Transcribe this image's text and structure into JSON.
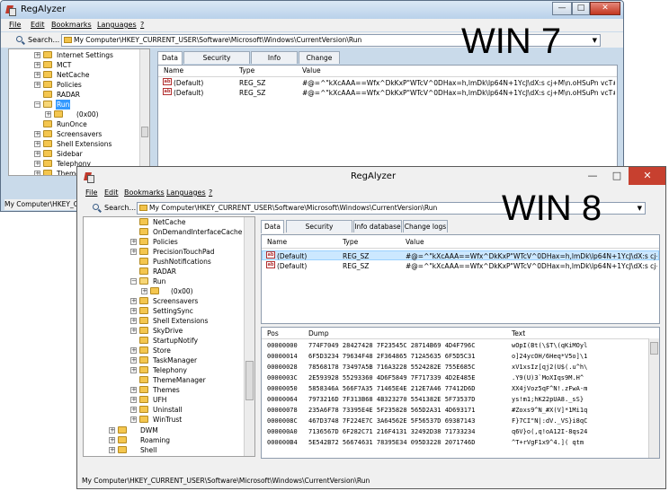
{
  "win7": {
    "title": "RegAlyzer",
    "label": "WIN 7",
    "menu": {
      "file": "File",
      "edit": "Edit",
      "bookmarks": "Bookmarks",
      "languages": "Languages",
      "help": "?"
    },
    "search_label": "Search...",
    "path": "My Computer\\HKEY_CURRENT_USER\\Software\\Microsoft\\Windows\\CurrentVersion\\Run",
    "tree": [
      "Internet Settings",
      "MCT",
      "NetCache",
      "Policies",
      "RADAR",
      "Run",
      "(0x00)",
      "RunOnce",
      "Screensavers",
      "Shell Extensions",
      "Sidebar",
      "Telephony",
      "Themes"
    ],
    "tabs": [
      "Data",
      "Security information",
      "Info database",
      "Change logs"
    ],
    "columns": [
      "Name",
      "Type",
      "Value"
    ],
    "rows": [
      {
        "name": "(Default)",
        "type": "REG_SZ",
        "value": "#@=^\"kXcAAA==Wfx^DkKxP\"WTcV^0DHax=h,lmDk\\lp64N+1YcJ\\dX:s cj+M\\n.oHSuPn vcT#lX..."
      },
      {
        "name": "(Default)",
        "type": "REG_SZ",
        "value": "#@=^\"kXcAAA==Wfx^DkKxP\"WTcV^0DHax=h,lmDk\\lp64N+1YcJ\\dX:s cj+M\\n.oHSuPn vcT#lX..."
      }
    ],
    "status": "My Computer\\HKEY_CU..."
  },
  "win8": {
    "title": "RegAlyzer",
    "label": "WIN 8",
    "menu": {
      "file": "File",
      "edit": "Edit",
      "bookmarks": "Bookmarks",
      "languages": "Languages",
      "help": "?"
    },
    "search_label": "Search...",
    "path": "My Computer\\HKEY_CURRENT_USER\\Software\\Microsoft\\Windows\\CurrentVersion\\Run",
    "tree": [
      "NetCache",
      "OnDemandInterfaceCache",
      "Policies",
      "PrecisionTouchPad",
      "PushNotifications",
      "RADAR",
      "Run",
      "(0x00)",
      "Screensavers",
      "SettingSync",
      "Shell Extensions",
      "SkyDrive",
      "StartupNotify",
      "Store",
      "TaskManager",
      "Telephony",
      "ThemeManager",
      "Themes",
      "UFH",
      "Uninstall",
      "WinTrust",
      "DWM",
      "Roaming",
      "Shell"
    ],
    "tabs": [
      "Data",
      "Security information",
      "Info database",
      "Change logs"
    ],
    "columns": [
      "Name",
      "Type",
      "Value"
    ],
    "rows": [
      {
        "name": "(Default)",
        "type": "REG_SZ",
        "value": "#@=^\"kXcAAA==Wfx^DkKxP\"WTcV^0DHax=h,lmDk\\lp64N+1YcJ\\dX:s cj+M\\n.oH..."
      },
      {
        "name": "(Default)",
        "type": "REG_SZ",
        "value": "#@=^\"kXcAAA==Wfx^DkKxP\"WTcV^0DHax=h,lmDk\\lp64N+1YcJ\\dX:s cj+M\\n.oH..."
      }
    ],
    "hex_columns": [
      "Pos",
      "Dump",
      "Text"
    ],
    "hex_rows": [
      {
        "pos": "00000000",
        "dump": "774F7049 28427428 7F23545C 28714B69 4D4F796C",
        "text": "wOpI(Bt(\\$T\\(qKiMOyl"
      },
      {
        "pos": "00000014",
        "dump": "6F5D3234 79634F48 2F364865 712A5635 6F5D5C31",
        "text": "o]24ycOH/6Heq*V5o]\\1"
      },
      {
        "pos": "00000028",
        "dump": "78568178 73497A5B 716A3228 5524282E 755E685C",
        "text": "xV1xsIz[qj2(U$(.u^h\\"
      },
      {
        "pos": "0000003C",
        "dump": "2E593928 55293360 4D6F5849 7F717339 4D2E485E",
        "text": ".Y9(U)3`MoXIqs9M.H^"
      },
      {
        "pos": "00000050",
        "dump": "5858346A 566F7A35 71465E4E 212E7A46 77412D6D",
        "text": "XX4jVoz5qF^N!.zFwA-m"
      },
      {
        "pos": "00000064",
        "dump": "7973216D 7F313B68 4B323270 5541382E 5F73537D",
        "text": "ys!m1;hK22pUA8._sS}"
      },
      {
        "pos": "00000078",
        "dump": "235A6F78 73395E4E 5F235828 565D2A31 4D693171",
        "text": "#Zoxs9^N_#X(V]*1Mi1q"
      },
      {
        "pos": "0000008C",
        "dump": "467D3748 7F224E7C 3A64562E 5F56537D 69387143",
        "text": "F}7CI\"N|:dV._VS}i8qC"
      },
      {
        "pos": "000000A0",
        "dump": "7136567D 6F282C71 216F4131 32492D38 71733234",
        "text": "q6V}o(,q!oA12I-8qs24"
      },
      {
        "pos": "000000B4",
        "dump": "5E542B72 56674631 78395E34 095D3228 2071746D",
        "text": "^T+rVgF1x9^4.]( qtm"
      }
    ],
    "status": "My Computer\\HKEY_CURRENT_USER\\Software\\Microsoft\\Windows\\CurrentVersion\\Run"
  }
}
